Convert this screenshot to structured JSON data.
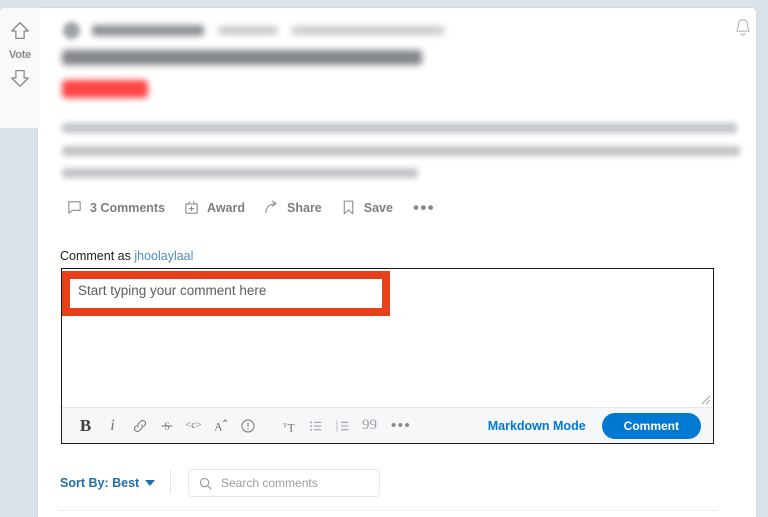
{
  "page": {
    "background_color": "#dae3ea",
    "card_background": "#ffffff"
  },
  "vote": {
    "label": "Vote",
    "upvote_icon": "upvote-arrow-icon",
    "downvote_icon": "downvote-arrow-icon"
  },
  "header": {
    "bell_icon": "notification-bell-icon",
    "author_redacted": "",
    "timestamp_redacted": "",
    "title_redacted": "",
    "flair_redacted": "",
    "flair_color": "#ff4444"
  },
  "body": {
    "paragraph_redacted": ""
  },
  "actions": [
    {
      "label": "3 Comments",
      "icon": "comment-bubble-icon"
    },
    {
      "label": "Award",
      "icon": "award-gift-icon"
    },
    {
      "label": "Share",
      "icon": "share-arrow-icon"
    },
    {
      "label": "Save",
      "icon": "bookmark-icon"
    },
    {
      "label": "•••",
      "icon": "more-options-icon"
    }
  ],
  "comment_as": {
    "prefix": "Comment as ",
    "username": "jhoolaylaal"
  },
  "editor": {
    "placeholder": "Start typing your comment here",
    "markdown_mode_label": "Markdown Mode",
    "submit_label": "Comment",
    "submit_color": "#0079d3",
    "toolbar": [
      {
        "name": "bold-icon",
        "glyph": "B"
      },
      {
        "name": "italic-icon",
        "glyph": "i"
      },
      {
        "name": "link-icon",
        "glyph": "⚗"
      },
      {
        "name": "strikethrough-icon",
        "glyph": "S"
      },
      {
        "name": "inline-code-icon",
        "glyph": "<c>"
      },
      {
        "name": "superscript-icon",
        "glyph": "A˄"
      },
      {
        "name": "spoiler-icon",
        "glyph": "!"
      },
      {
        "name": "heading-icon",
        "glyph": "ᴛT"
      },
      {
        "name": "bulleted-list-icon",
        "glyph": "≡"
      },
      {
        "name": "numbered-list-icon",
        "glyph": "≡"
      },
      {
        "name": "quote-icon",
        "glyph": "99"
      },
      {
        "name": "more-formatting-icon",
        "glyph": "•••"
      }
    ]
  },
  "highlight": {
    "color": "#e8401a",
    "target": "comment-placeholder"
  },
  "footer": {
    "sort_by_label": "Sort By: Best",
    "search_placeholder": "Search comments",
    "search_icon": "search-magnifier-icon"
  }
}
